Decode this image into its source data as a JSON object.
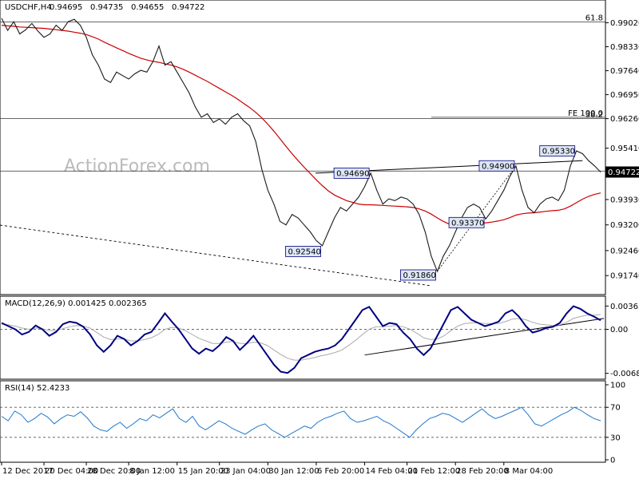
{
  "chart_data": {
    "type": "line",
    "main": {
      "symbol": "USDCHF,H4",
      "ohlc": [
        "0.94695",
        "0.94735",
        "0.94655",
        "0.94722"
      ],
      "current_price": 0.94722,
      "current_label": "0.94722",
      "ylim": [
        0.914,
        0.994
      ],
      "y_ticks": [
        {
          "value": 0.9902,
          "label": "0.99020"
        },
        {
          "value": 0.9833,
          "label": "0.98330"
        },
        {
          "value": 0.9764,
          "label": "0.97640"
        },
        {
          "value": 0.9695,
          "label": "0.96950"
        },
        {
          "value": 0.9626,
          "label": "0.96260"
        },
        {
          "value": 0.9541,
          "label": "0.95410"
        },
        {
          "value": 0.9472,
          "label": "0.94720"
        },
        {
          "value": 0.9393,
          "label": "0.93930"
        },
        {
          "value": 0.932,
          "label": "0.93200"
        },
        {
          "value": 0.9246,
          "label": "0.92460"
        },
        {
          "value": 0.9174,
          "label": "0.91740"
        }
      ],
      "levels": [
        {
          "label": "61.8",
          "value": 0.9904
        },
        {
          "label": "FE 100.0",
          "value": 0.963
        },
        {
          "label": "38.2",
          "value": 0.9626
        },
        {
          "label": "",
          "value": 0.9475
        }
      ],
      "annotations": [
        {
          "label": "0.95330",
          "value": 0.9533
        },
        {
          "label": "0.94900",
          "value": 0.949
        },
        {
          "label": "0.94690",
          "value": 0.9469
        },
        {
          "label": "0.93370",
          "value": 0.9337
        },
        {
          "label": "0.92540",
          "value": 0.9254
        },
        {
          "label": "0.91860",
          "value": 0.9186
        }
      ],
      "price_path": [
        0.9915,
        0.988,
        0.9905,
        0.987,
        0.9882,
        0.99,
        0.9878,
        0.986,
        0.987,
        0.9895,
        0.988,
        0.9905,
        0.9912,
        0.9895,
        0.986,
        0.981,
        0.978,
        0.974,
        0.973,
        0.976,
        0.975,
        0.974,
        0.9755,
        0.9765,
        0.976,
        0.979,
        0.9835,
        0.978,
        0.979,
        0.976,
        0.973,
        0.97,
        0.966,
        0.963,
        0.964,
        0.9615,
        0.9625,
        0.961,
        0.963,
        0.964,
        0.962,
        0.9605,
        0.956,
        0.948,
        0.942,
        0.938,
        0.933,
        0.932,
        0.935,
        0.934,
        0.932,
        0.93,
        0.9275,
        0.926,
        0.93,
        0.934,
        0.937,
        0.936,
        0.938,
        0.94,
        0.943,
        0.9469,
        0.942,
        0.938,
        0.9395,
        0.939,
        0.94,
        0.9395,
        0.938,
        0.935,
        0.93,
        0.923,
        0.9186,
        0.923,
        0.926,
        0.93,
        0.934,
        0.937,
        0.938,
        0.937,
        0.9337,
        0.936,
        0.939,
        0.942,
        0.946,
        0.949,
        0.942,
        0.937,
        0.9355,
        0.938,
        0.9395,
        0.94,
        0.939,
        0.942,
        0.949,
        0.9533,
        0.9525,
        0.9505,
        0.949,
        0.9472
      ],
      "ma_path": [
        0.9895,
        0.9893,
        0.9892,
        0.989,
        0.9889,
        0.9888,
        0.9887,
        0.9886,
        0.9884,
        0.9882,
        0.988,
        0.9878,
        0.9875,
        0.9872,
        0.9868,
        0.9862,
        0.9855,
        0.9846,
        0.9838,
        0.983,
        0.9822,
        0.9814,
        0.9807,
        0.98,
        0.9795,
        0.9791,
        0.9788,
        0.9784,
        0.978,
        0.9775,
        0.9768,
        0.976,
        0.9751,
        0.9742,
        0.9733,
        0.9723,
        0.9713,
        0.9703,
        0.9693,
        0.9682,
        0.967,
        0.9658,
        0.9644,
        0.9628,
        0.961,
        0.959,
        0.9568,
        0.9546,
        0.9525,
        0.9505,
        0.9486,
        0.9468,
        0.945,
        0.9433,
        0.9418,
        0.9406,
        0.9398,
        0.939,
        0.9385,
        0.938,
        0.9378,
        0.9378,
        0.9377,
        0.9376,
        0.9375,
        0.9374,
        0.9373,
        0.9372,
        0.937,
        0.9366,
        0.936,
        0.9351,
        0.934,
        0.933,
        0.9322,
        0.9318,
        0.9318,
        0.932,
        0.9323,
        0.9325,
        0.9326,
        0.9328,
        0.9331,
        0.9335,
        0.9341,
        0.9348,
        0.9352,
        0.9354,
        0.9355,
        0.9357,
        0.9359,
        0.9361,
        0.9362,
        0.9366,
        0.9374,
        0.9384,
        0.9394,
        0.9402,
        0.9408,
        0.9412
      ]
    },
    "macd": {
      "label": "MACD(12,26,9) 0.001425 0.002365",
      "ylim": [
        -0.0074,
        0.0043
      ],
      "y_ticks": [
        {
          "value": 0.003638,
          "label": "0.003638"
        },
        {
          "value": 0.0,
          "label": "0.00"
        },
        {
          "value": -0.006858,
          "label": "-0.006858"
        }
      ],
      "macd_path": [
        0.001,
        0.0005,
        0.0,
        -0.0008,
        -0.0004,
        0.0006,
        0.0,
        -0.001,
        -0.0004,
        0.0008,
        0.0012,
        0.001,
        0.0004,
        -0.0008,
        -0.0025,
        -0.0035,
        -0.0025,
        -0.001,
        -0.0015,
        -0.0025,
        -0.0018,
        -0.0008,
        -0.0004,
        0.001,
        0.0025,
        0.0012,
        0.0,
        -0.0015,
        -0.003,
        -0.0038,
        -0.003,
        -0.0034,
        -0.0025,
        -0.0012,
        -0.0018,
        -0.0032,
        -0.0022,
        -0.001,
        -0.0025,
        -0.004,
        -0.0055,
        -0.0066,
        -0.0068,
        -0.006,
        -0.0045,
        -0.004,
        -0.0035,
        -0.0032,
        -0.003,
        -0.0025,
        -0.0015,
        0.0,
        0.0015,
        0.003,
        0.0035,
        0.002,
        0.0005,
        0.001,
        0.0008,
        -0.0005,
        -0.0015,
        -0.003,
        -0.004,
        -0.003,
        -0.001,
        0.001,
        0.003,
        0.0035,
        0.0025,
        0.0015,
        0.001,
        0.0005,
        0.0008,
        0.0012,
        0.0025,
        0.003,
        0.002,
        0.0005,
        -0.0005,
        -0.0002,
        0.0002,
        0.0004,
        0.001,
        0.0025,
        0.0036,
        0.0032,
        0.0025,
        0.002,
        0.0014
      ],
      "signal_path": [
        0.0008,
        0.0007,
        0.0005,
        0.0002,
        0.0,
        0.0002,
        0.0001,
        -0.0002,
        -0.0002,
        0.0001,
        0.0004,
        0.0006,
        0.0005,
        0.0002,
        -0.0005,
        -0.0012,
        -0.0016,
        -0.0015,
        -0.0015,
        -0.0018,
        -0.0018,
        -0.0016,
        -0.0013,
        -0.0008,
        0.0,
        0.0003,
        0.0002,
        -0.0002,
        -0.0008,
        -0.0014,
        -0.0018,
        -0.0022,
        -0.0022,
        -0.002,
        -0.0019,
        -0.0022,
        -0.0022,
        -0.002,
        -0.0021,
        -0.0025,
        -0.0032,
        -0.0039,
        -0.0045,
        -0.0048,
        -0.0048,
        -0.0046,
        -0.0044,
        -0.0041,
        -0.0039,
        -0.0036,
        -0.0032,
        -0.0025,
        -0.0017,
        -0.0008,
        0.0,
        0.0004,
        0.0004,
        0.0005,
        0.0006,
        0.0004,
        0.0,
        -0.0006,
        -0.0013,
        -0.0016,
        -0.0015,
        -0.001,
        -0.0002,
        0.0005,
        0.0009,
        0.001,
        0.001,
        0.0009,
        0.0009,
        0.0009,
        0.0012,
        0.0016,
        0.0017,
        0.0015,
        0.0011,
        0.0008,
        0.0007,
        0.0006,
        0.0007,
        0.0011,
        0.0017,
        0.002,
        0.0022,
        0.0022,
        0.0023
      ]
    },
    "rsi": {
      "label": "RSI(14) 52.4233",
      "ylim": [
        0,
        100
      ],
      "y_ticks": [
        {
          "value": 100,
          "label": "100"
        },
        {
          "value": 70,
          "label": "70"
        },
        {
          "value": 30,
          "label": "30"
        },
        {
          "value": 0,
          "label": "0"
        }
      ],
      "levels": [
        70,
        30
      ],
      "rsi_path": [
        58,
        52,
        65,
        60,
        50,
        55,
        62,
        57,
        48,
        55,
        60,
        58,
        64,
        56,
        45,
        40,
        38,
        45,
        50,
        42,
        48,
        55,
        52,
        60,
        56,
        62,
        68,
        55,
        50,
        58,
        45,
        40,
        46,
        52,
        48,
        42,
        38,
        34,
        40,
        45,
        48,
        40,
        35,
        30,
        35,
        40,
        45,
        42,
        50,
        55,
        58,
        62,
        65,
        55,
        50,
        52,
        55,
        58,
        52,
        48,
        42,
        36,
        30,
        40,
        48,
        55,
        58,
        62,
        60,
        55,
        50,
        56,
        62,
        68,
        60,
        55,
        58,
        62,
        66,
        70,
        60,
        48,
        45,
        50,
        55,
        60,
        64,
        70,
        66,
        60,
        55,
        52
      ]
    },
    "x_ticks": [
      {
        "index": 0,
        "label": "12 Dec 2017"
      },
      {
        "index": 7,
        "label": "20 Dec 04:00"
      },
      {
        "index": 14,
        "label": "28 Dec 20:00"
      },
      {
        "index": 21,
        "label": "8 Jan 12:00"
      },
      {
        "index": 29,
        "label": "15 Jan 20:00"
      },
      {
        "index": 36,
        "label": "23 Jan 04:00"
      },
      {
        "index": 44,
        "label": "30 Jan 12:00"
      },
      {
        "index": 52,
        "label": "6 Feb 20:00"
      },
      {
        "index": 60,
        "label": "14 Feb 04:00"
      },
      {
        "index": 67,
        "label": "21 Feb 12:00"
      },
      {
        "index": 75,
        "label": "28 Feb 20:00"
      },
      {
        "index": 83,
        "label": "8 Mar 04:00"
      }
    ],
    "watermark": "ActionForex.com",
    "colors": {
      "price": "#1a1a1a",
      "ma": "#cc0000",
      "macd": "#000080",
      "signal": "#aaaaaa",
      "rsi": "#2277cc",
      "label_bg": "#dde6f5",
      "label_border": "#000080"
    }
  }
}
